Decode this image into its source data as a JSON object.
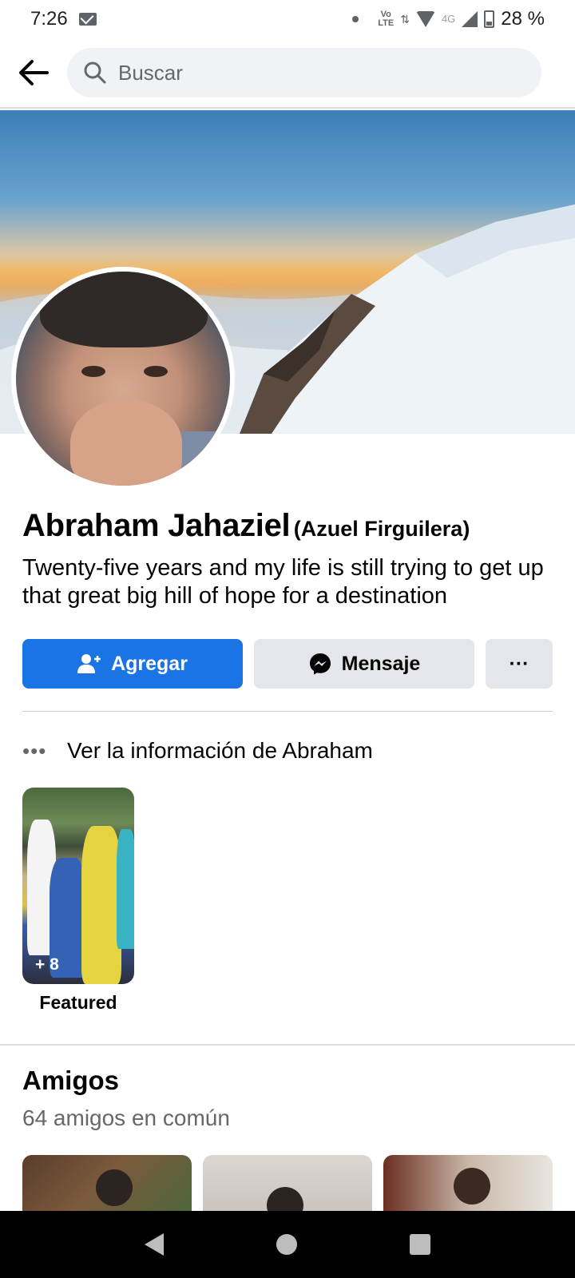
{
  "status_bar": {
    "time": "7:26",
    "network_label": "4G",
    "volte_top": "Vo",
    "volte_bottom": "LTE",
    "battery": "28 %"
  },
  "header": {
    "search_placeholder": "Buscar"
  },
  "profile": {
    "name": "Abraham Jahaziel",
    "alternate_name": "(Azuel Firguilera)",
    "bio": "Twenty-five years and my life is still trying to get up that great big hill of hope for a destination"
  },
  "actions": {
    "add_label": "Agregar",
    "message_label": "Mensaje",
    "more_label": "···"
  },
  "info": {
    "dots": "•••",
    "label": "Ver la información de Abraham"
  },
  "featured": {
    "count_label": "+ 8",
    "label": "Featured"
  },
  "friends": {
    "title": "Amigos",
    "subtitle": "64 amigos en común"
  },
  "colors": {
    "primary": "#1b74e4",
    "secondary_button": "#e4e6eb",
    "search_bg": "#f0f2f5",
    "muted_text": "#65676b"
  },
  "icons": {
    "back": "arrow-left-icon",
    "search": "search-icon",
    "add_friend": "add-friend-icon",
    "messenger": "messenger-icon",
    "more": "more-dots-icon"
  }
}
